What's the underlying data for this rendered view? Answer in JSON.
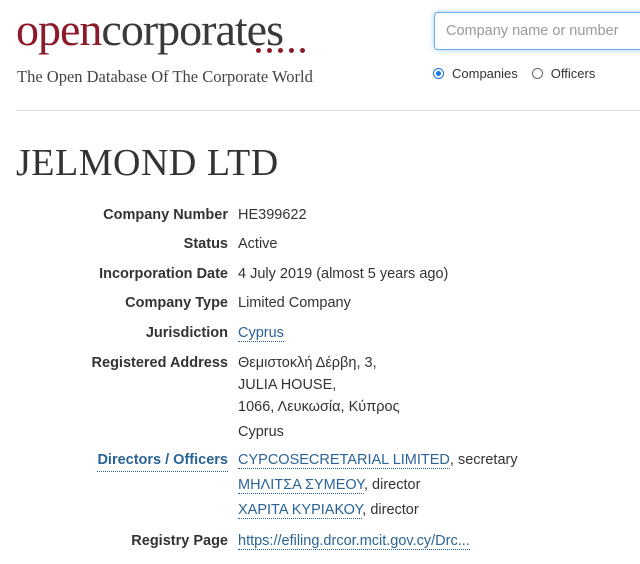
{
  "header": {
    "logo_open": "open",
    "logo_corporates": "corporates",
    "tagline": "The Open Database Of The Corporate World",
    "search_placeholder": "Company name or number",
    "radio_companies": "Companies",
    "radio_officers": "Officers",
    "selected": "Companies"
  },
  "company": {
    "name": "JELMOND LTD",
    "number_label": "Company Number",
    "number": "HE399622",
    "status_label": "Status",
    "status": "Active",
    "incorporation_label": "Incorporation Date",
    "incorporation": "4 July 2019 (almost 5 years ago)",
    "type_label": "Company Type",
    "type": "Limited Company",
    "jurisdiction_label": "Jurisdiction",
    "jurisdiction": "Cyprus",
    "address_label": "Registered Address",
    "address": [
      "Θεμιστοκλή Δέρβη, 3,",
      "JULIA HOUSE,",
      "1066, Λευκωσία, Κύπρος",
      "Cyprus"
    ],
    "officers_label": "Directors / Officers",
    "officers": [
      {
        "name": "CYPCOSECRETARIAL LIMITED",
        "role": ", secretary"
      },
      {
        "name": "ΜΗΛΙΤΣΑ ΣΥΜΕΟΥ",
        "role": ", director"
      },
      {
        "name": "ΧΑΡΙΤΑ ΚΥΡΙΑΚΟΥ",
        "role": ", director"
      }
    ],
    "registry_label": "Registry Page",
    "registry": "https://efiling.drcor.mcit.gov.cy/Drc..."
  },
  "colors": {
    "brand": "#8b1a2b",
    "link": "#2a6496"
  }
}
